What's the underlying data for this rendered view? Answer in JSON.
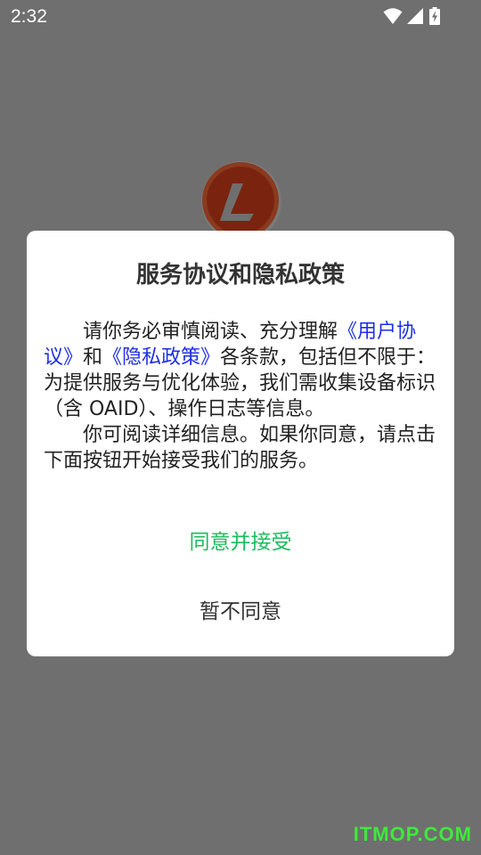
{
  "status_bar": {
    "time": "2:32",
    "icons": [
      "wifi-icon",
      "cellular-signal-icon",
      "battery-charging-icon"
    ]
  },
  "app_logo": {
    "icon": "app-logo-icon",
    "colors": {
      "ring": "#d44a19",
      "inner": "#9d2c0f",
      "glyph": "#ffffff"
    }
  },
  "dialog": {
    "title": "服务协议和隐私政策",
    "body": {
      "p1_pre": "请你务必审慎阅读、充分理解",
      "link_user_agreement": "《用户协议》",
      "p1_and": "和",
      "link_privacy_policy": "《隐私政策》",
      "p1_post": "各条款，包括但不限于：为提供服务与优化体验，我们需收集设备标识（含 OAID）、操作日志等信息。",
      "p2": "你可阅读详细信息。如果你同意，请点击下面按钮开始接受我们的服务。"
    },
    "agree_button": "同意并接受",
    "decline_button": "暂不同意",
    "colors": {
      "link": "#1e2ee6",
      "agree": "#1dbb5d"
    }
  },
  "watermark": "ITMOP.COM"
}
